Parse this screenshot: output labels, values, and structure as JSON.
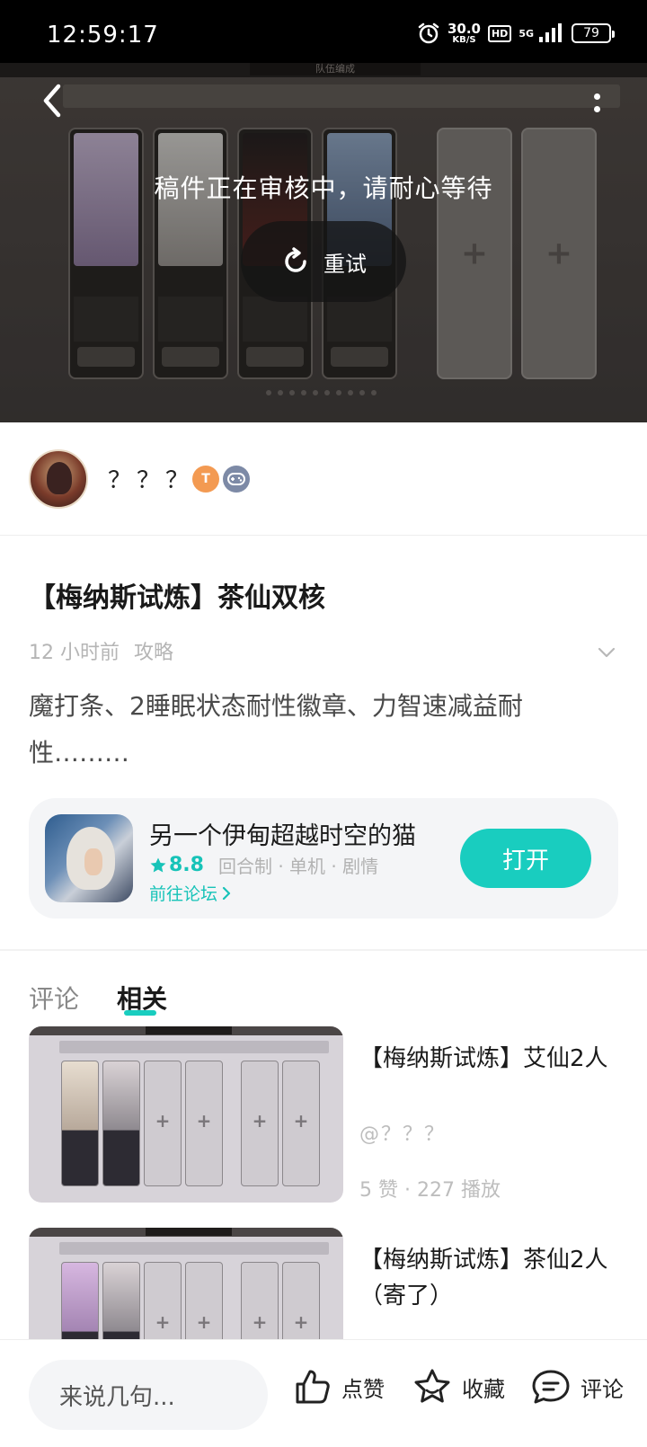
{
  "status_bar": {
    "time": "12:59:17",
    "net_speed": "30.0",
    "net_unit": "KB/S",
    "hd": "HD",
    "signal": "5G",
    "battery": "79"
  },
  "video": {
    "game_header": "队伍编成",
    "review_message": "稿件正在审核中，请耐心等待",
    "retry_label": "重试"
  },
  "author": {
    "name": "？？？",
    "badge_level": "T"
  },
  "post": {
    "title": "【梅纳斯试炼】茶仙双核",
    "time_ago": "12 小时前",
    "category": "攻略",
    "body": "魔打条、2睡眠状态耐性徽章、力智速减益耐性………"
  },
  "game": {
    "name": "另一个伊甸超越时空的猫",
    "rating": "8.8",
    "tags": "回合制 · 单机 · 剧情",
    "forum_link": "前往论坛",
    "open_label": "打开"
  },
  "tabs": [
    {
      "label": "评论"
    },
    {
      "label": "相关"
    }
  ],
  "related": [
    {
      "title": "【梅纳斯试炼】艾仙2人",
      "author": "@？？？",
      "stats": "5 赞 · 227 播放"
    },
    {
      "title": "【梅纳斯试炼】茶仙2人（寄了）",
      "author": "",
      "stats": ""
    }
  ],
  "bottom_bar": {
    "input_placeholder": "来说几句...",
    "like_label": "点赞",
    "favorite_label": "收藏",
    "comment_label": "评论"
  },
  "colors": {
    "accent": "#19cdbf",
    "text_primary": "#1a1a1a",
    "text_muted": "#b5b5b5"
  }
}
